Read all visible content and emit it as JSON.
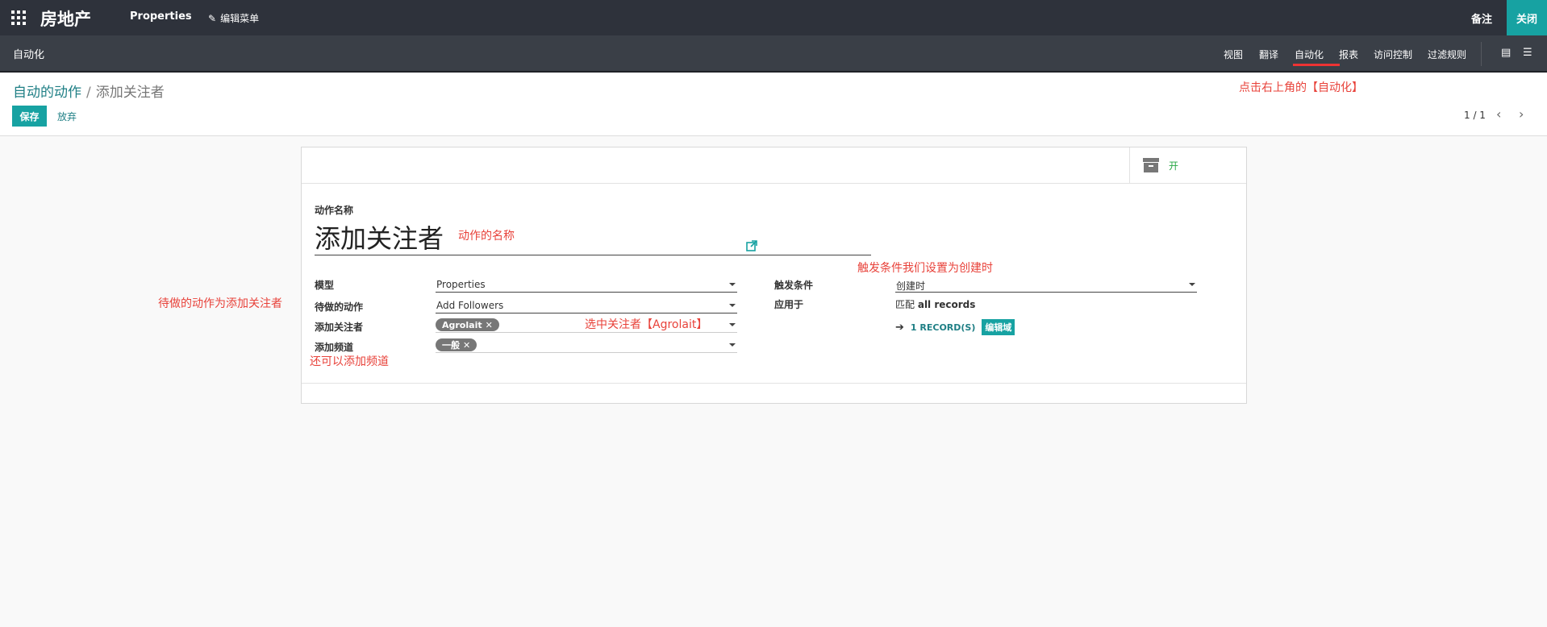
{
  "topbar": {
    "brand": "房地产",
    "menu_properties": "Properties",
    "menu_edit": "编辑菜单",
    "note": "备注",
    "close": "关闭"
  },
  "subbar": {
    "title": "自动化",
    "tabs": [
      "视图",
      "翻译",
      "自动化",
      "报表",
      "访问控制",
      "过滤规则"
    ],
    "active_tab": "自动化"
  },
  "breadcrumb": {
    "parent": "自动的动作",
    "separator": "/",
    "current": "添加关注者"
  },
  "control": {
    "save": "保存",
    "discard": "放弃",
    "pager": "1 / 1"
  },
  "sheet": {
    "toggle_label": "开",
    "name_label": "动作名称",
    "name_value": "添加关注者",
    "fields": {
      "model_label": "模型",
      "model_value": "Properties",
      "action_label": "待做的动作",
      "action_value": "Add Followers",
      "followers_label": "添加关注者",
      "followers_tag": "Agrolait",
      "channels_label": "添加频道",
      "channels_tag": "一般",
      "trigger_label": "触发条件",
      "trigger_value": "创建时",
      "apply_label": "应用于",
      "apply_prefix": "匹配",
      "apply_value": "all records",
      "records_link": "1 RECORD(S)",
      "edit_domain": "编辑域"
    }
  },
  "annotations": {
    "top_right": "点击右上角的【自动化】",
    "name": "动作的名称",
    "trigger": "触发条件我们设置为创建时",
    "action": "待做的动作为添加关注者",
    "followers": "选中关注者【Agrolait】",
    "channels": "还可以添加频道"
  },
  "colors": {
    "nav": "#2e323b",
    "accent": "#17a2a2",
    "annotation": "#e8423a"
  }
}
